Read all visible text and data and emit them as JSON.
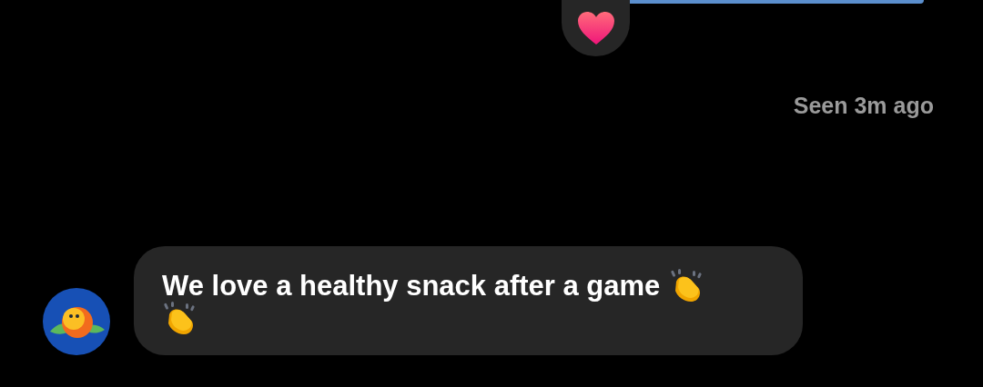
{
  "sent_message": {
    "reaction": {
      "kind": "heart"
    }
  },
  "status": "Seen 3m ago",
  "received_message": {
    "lines": [
      {
        "text": "We love a healthy snack after a game",
        "emoji": [
          {
            "kind": "clap"
          }
        ]
      },
      {
        "emoji": [
          {
            "kind": "clap"
          }
        ]
      }
    ]
  }
}
